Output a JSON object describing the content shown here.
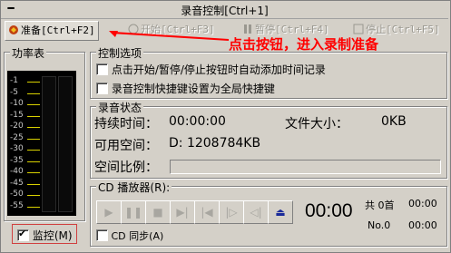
{
  "window": {
    "title": "录音控制[Ctrl+1]",
    "minimize": "━"
  },
  "toolbar": {
    "prepare": "准备[Ctrl+F2]",
    "start": "开始[Ctrl+F3]",
    "pause": "暂停[Ctrl+F4]",
    "stop": "停止[Ctrl+F5]"
  },
  "annotation": {
    "text": "点击按钮，进入录制准备",
    "color": "#ff0000"
  },
  "meter": {
    "title": "功率表",
    "ticks": [
      "-1",
      "-5",
      "-10",
      "-15",
      "-20",
      "-25",
      "-30",
      "-35",
      "-40",
      "-45",
      "-50",
      "-55"
    ]
  },
  "monitor": {
    "label": "监控(M)",
    "checked": true
  },
  "control_options": {
    "title": "控制选项",
    "options": [
      "点击开始/暂停/停止按钮时自动添加时间记录",
      "录音控制快捷键设置为全局快捷键"
    ]
  },
  "record_status": {
    "title": "录音状态",
    "duration_label": "持续时间：",
    "duration_value": "00:00:00",
    "filesize_label": "文件大小：",
    "filesize_value": "0KB",
    "space_label": "可用空间：",
    "space_value": "D: 1208784KB",
    "ratio_label": "空间比例："
  },
  "cd_player": {
    "title": "CD 播放器(R):",
    "time": "00:00",
    "total_label": "共 0首",
    "total_time": "00:00",
    "track_label": "No.0",
    "track_time": "00:00",
    "sync_label": "CD 同步(A)"
  }
}
